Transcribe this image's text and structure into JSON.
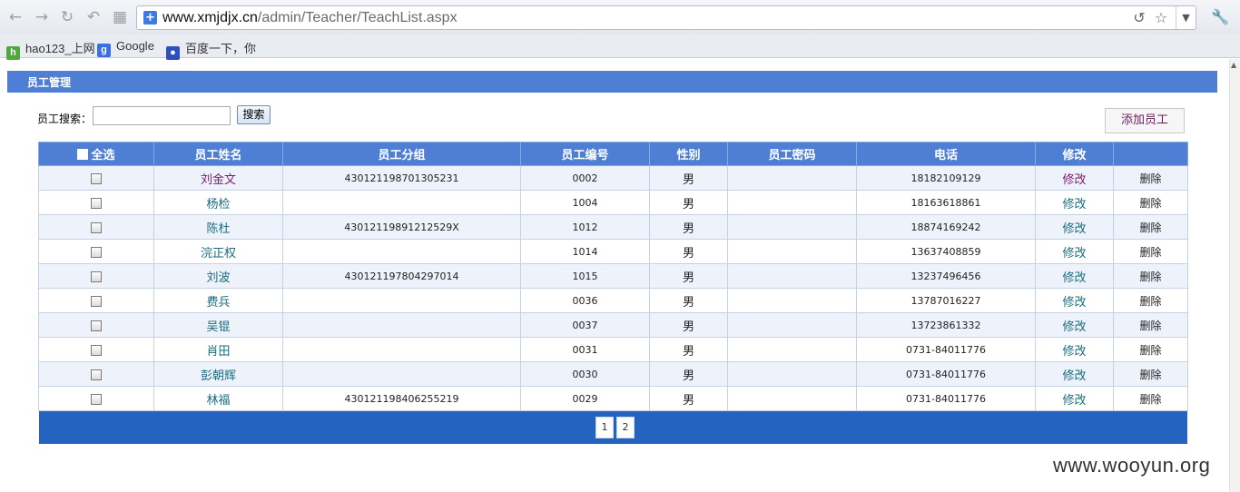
{
  "browser": {
    "url_host": "www.xmjdjx.cn",
    "url_path": "/admin/Teacher/TeachList.aspx",
    "bookmarks": [
      {
        "label": "hao123_上网",
        "icon": "hao123-icon",
        "color": "#4fa83d"
      },
      {
        "label": "Google",
        "icon": "google-icon",
        "color": "#3b6ee0"
      },
      {
        "label": "百度一下，你",
        "icon": "baidu-paw-icon",
        "color": "#2f4fbf"
      }
    ]
  },
  "page": {
    "section_title": "员工管理",
    "search_label": "员工搜索：",
    "search_value": "",
    "search_button": "搜索",
    "add_button": "添加员工",
    "select_all": "全选"
  },
  "table": {
    "headers": [
      "员工姓名",
      "员工分组",
      "员工编号",
      "性别",
      "员工密码",
      "电话",
      "修改",
      ""
    ],
    "edit_label": "修改",
    "delete_label": "删除",
    "rows": [
      {
        "name": "刘金文",
        "group": "430121198701305231",
        "id": "0002",
        "gender": "男",
        "password": "",
        "phone": "18182109129"
      },
      {
        "name": "杨检",
        "group": "",
        "id": "1004",
        "gender": "男",
        "password": "",
        "phone": "18163618861"
      },
      {
        "name": "陈杜",
        "group": "43012119891212529X",
        "id": "1012",
        "gender": "男",
        "password": "",
        "phone": "18874169242"
      },
      {
        "name": "浣正权",
        "group": "",
        "id": "1014",
        "gender": "男",
        "password": "",
        "phone": "13637408859"
      },
      {
        "name": "刘波",
        "group": "430121197804297014",
        "id": "1015",
        "gender": "男",
        "password": "",
        "phone": "13237496456"
      },
      {
        "name": "费兵",
        "group": "",
        "id": "0036",
        "gender": "男",
        "password": "",
        "phone": "13787016227"
      },
      {
        "name": "吴锟",
        "group": "",
        "id": "0037",
        "gender": "男",
        "password": "",
        "phone": "13723861332"
      },
      {
        "name": "肖田",
        "group": "",
        "id": "0031",
        "gender": "男",
        "password": "",
        "phone": "0731-84011776"
      },
      {
        "name": "彭朝辉",
        "group": "",
        "id": "0030",
        "gender": "男",
        "password": "",
        "phone": "0731-84011776"
      },
      {
        "name": "林福",
        "group": "430121198406255219",
        "id": "0029",
        "gender": "男",
        "password": "",
        "phone": "0731-84011776"
      }
    ]
  },
  "pager": {
    "pages": [
      "1",
      "2"
    ]
  },
  "watermark": "www.wooyun.org"
}
